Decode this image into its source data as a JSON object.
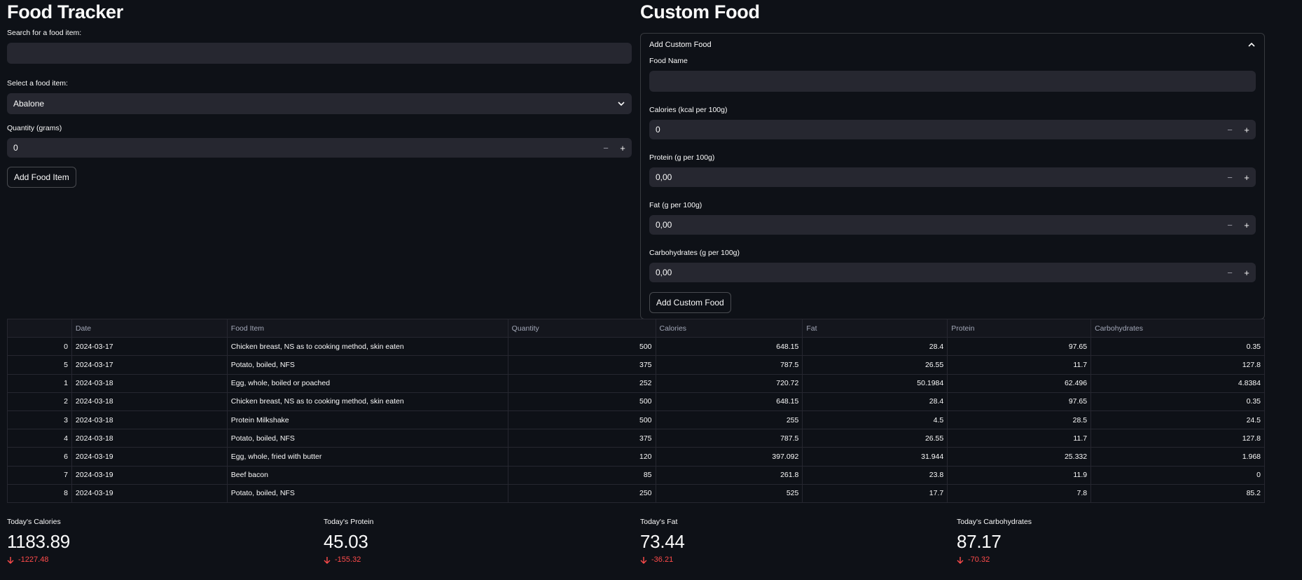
{
  "left": {
    "title": "Food Tracker",
    "search_label": "Search for a food item:",
    "search_value": "",
    "select_label": "Select a food item:",
    "select_value": "Abalone",
    "quantity_label": "Quantity (grams)",
    "quantity_value": "0",
    "add_button": "Add Food Item"
  },
  "right": {
    "title": "Custom Food",
    "expander_title": "Add Custom Food",
    "name_label": "Food Name",
    "name_value": "",
    "calories_label": "Calories (kcal per 100g)",
    "calories_value": "0",
    "protein_label": "Protein (g per 100g)",
    "protein_value": "0,00",
    "fat_label": "Fat (g per 100g)",
    "fat_value": "0,00",
    "carbs_label": "Carbohydrates (g per 100g)",
    "carbs_value": "0,00",
    "add_button": "Add Custom Food"
  },
  "table": {
    "columns": [
      "",
      "Date",
      "Food Item",
      "Quantity",
      "Calories",
      "Fat",
      "Protein",
      "Carbohydrates"
    ],
    "rows": [
      [
        "0",
        "2024-03-17",
        "Chicken breast, NS as to cooking method, skin eaten",
        "500",
        "648.15",
        "28.4",
        "97.65",
        "0.35"
      ],
      [
        "5",
        "2024-03-17",
        "Potato, boiled, NFS",
        "375",
        "787.5",
        "26.55",
        "11.7",
        "127.8"
      ],
      [
        "1",
        "2024-03-18",
        "Egg, whole, boiled or poached",
        "252",
        "720.72",
        "50.1984",
        "62.496",
        "4.8384"
      ],
      [
        "2",
        "2024-03-18",
        "Chicken breast, NS as to cooking method, skin eaten",
        "500",
        "648.15",
        "28.4",
        "97.65",
        "0.35"
      ],
      [
        "3",
        "2024-03-18",
        "Protein Milkshake",
        "500",
        "255",
        "4.5",
        "28.5",
        "24.5"
      ],
      [
        "4",
        "2024-03-18",
        "Potato, boiled, NFS",
        "375",
        "787.5",
        "26.55",
        "11.7",
        "127.8"
      ],
      [
        "6",
        "2024-03-19",
        "Egg, whole, fried with butter",
        "120",
        "397.092",
        "31.944",
        "25.332",
        "1.968"
      ],
      [
        "7",
        "2024-03-19",
        "Beef bacon",
        "85",
        "261.8",
        "23.8",
        "11.9",
        "0"
      ],
      [
        "8",
        "2024-03-19",
        "Potato, boiled, NFS",
        "250",
        "525",
        "17.7",
        "7.8",
        "85.2"
      ]
    ]
  },
  "metrics": [
    {
      "label": "Today's Calories",
      "value": "1183.89",
      "delta": "-1227.48"
    },
    {
      "label": "Today's Protein",
      "value": "45.03",
      "delta": "-155.32"
    },
    {
      "label": "Today's Fat",
      "value": "73.44",
      "delta": "-36.21"
    },
    {
      "label": "Today's Carbohydrates",
      "value": "87.17",
      "delta": "-70.32"
    }
  ],
  "colors": {
    "background": "#0e1117",
    "input": "#262730",
    "delta_negative": "#ff4b4b"
  },
  "icons": {
    "select": "chevron-down-icon",
    "expander": "chevron-up-icon",
    "delta": "arrow-down-icon",
    "minus": "minus-icon",
    "plus": "plus-icon"
  }
}
